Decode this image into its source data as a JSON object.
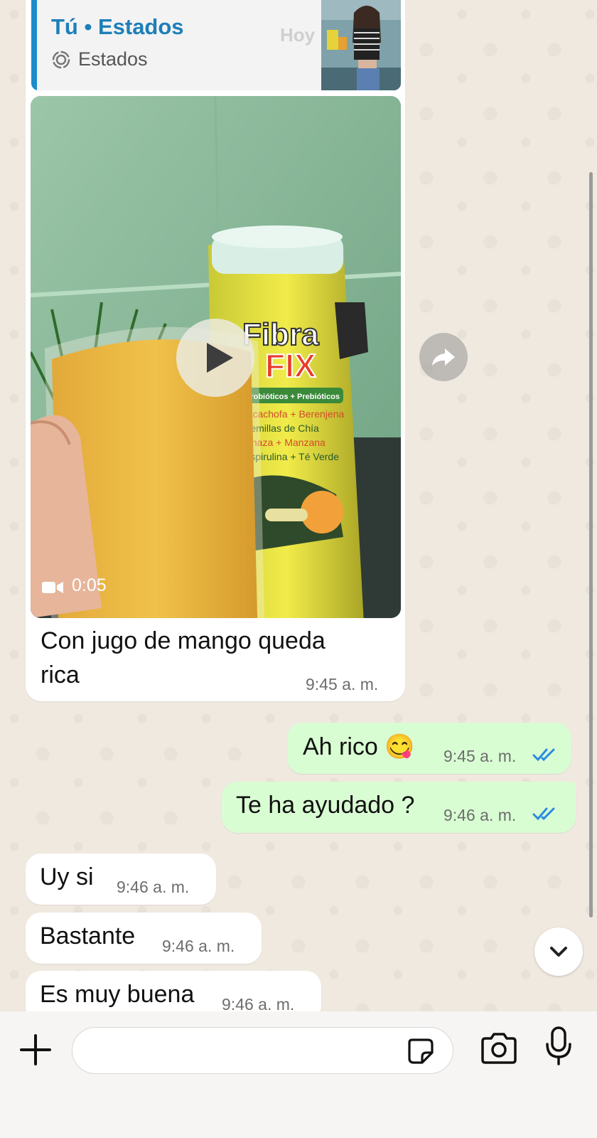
{
  "reply_quote": {
    "title": "Tú • Estados",
    "subtitle": "Estados",
    "date_label": "Hoy"
  },
  "video_message": {
    "duration": "0:05",
    "caption_line1": "Con jugo de mango queda",
    "caption_line2": "rica",
    "time": "9:45 a. m.",
    "product_brand": "Fibra Fix",
    "product_subtitle": "Probióticos + Prebióticos",
    "product_ingredients": [
      "Alcachofa + Berenjena",
      "Semillas de Chía",
      "Linaza + Manzana",
      "Espirulina + Té Verde"
    ]
  },
  "messages": [
    {
      "direction": "out",
      "text": "Ah rico 😋",
      "time": "9:45 a. m.",
      "status": "read"
    },
    {
      "direction": "out",
      "text": "Te ha ayudado ?",
      "time": "9:46 a. m.",
      "status": "read"
    },
    {
      "direction": "in",
      "text": "Uy si",
      "time": "9:46 a. m."
    },
    {
      "direction": "in",
      "text": "Bastante",
      "time": "9:46 a. m."
    },
    {
      "direction": "in",
      "text": "Es muy buena",
      "time": "9:46 a. m."
    }
  ],
  "input": {
    "value": "",
    "placeholder": ""
  },
  "colors": {
    "chat_background": "#efe9e0",
    "outgoing_bubble": "#d9fdd3",
    "incoming_bubble": "#ffffff",
    "read_ticks": "#2b8be0",
    "quote_accent": "#1a8ccc"
  },
  "icons": [
    "status-icon",
    "play-icon",
    "video-camera-icon",
    "forward-icon",
    "double-check-icon",
    "chevron-down-icon",
    "plus-icon",
    "sticker-icon",
    "camera-icon",
    "microphone-icon"
  ]
}
